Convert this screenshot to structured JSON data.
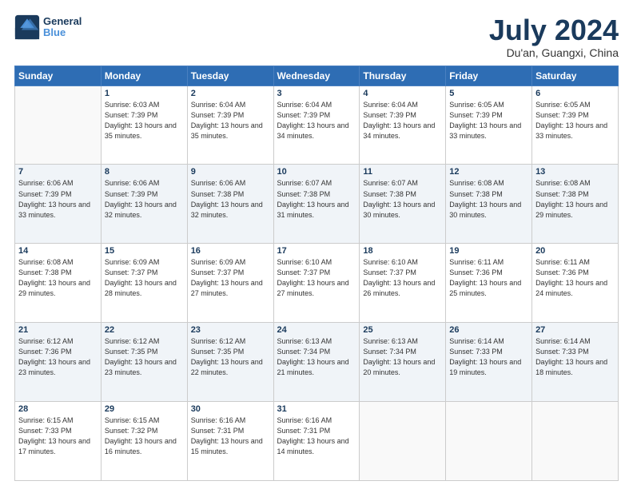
{
  "header": {
    "logo_line1": "General",
    "logo_line2": "Blue",
    "month_year": "July 2024",
    "location": "Du'an, Guangxi, China"
  },
  "days_of_week": [
    "Sunday",
    "Monday",
    "Tuesday",
    "Wednesday",
    "Thursday",
    "Friday",
    "Saturday"
  ],
  "weeks": [
    [
      {
        "day": "",
        "sunrise": "",
        "sunset": "",
        "daylight": ""
      },
      {
        "day": "1",
        "sunrise": "Sunrise: 6:03 AM",
        "sunset": "Sunset: 7:39 PM",
        "daylight": "Daylight: 13 hours and 35 minutes."
      },
      {
        "day": "2",
        "sunrise": "Sunrise: 6:04 AM",
        "sunset": "Sunset: 7:39 PM",
        "daylight": "Daylight: 13 hours and 35 minutes."
      },
      {
        "day": "3",
        "sunrise": "Sunrise: 6:04 AM",
        "sunset": "Sunset: 7:39 PM",
        "daylight": "Daylight: 13 hours and 34 minutes."
      },
      {
        "day": "4",
        "sunrise": "Sunrise: 6:04 AM",
        "sunset": "Sunset: 7:39 PM",
        "daylight": "Daylight: 13 hours and 34 minutes."
      },
      {
        "day": "5",
        "sunrise": "Sunrise: 6:05 AM",
        "sunset": "Sunset: 7:39 PM",
        "daylight": "Daylight: 13 hours and 33 minutes."
      },
      {
        "day": "6",
        "sunrise": "Sunrise: 6:05 AM",
        "sunset": "Sunset: 7:39 PM",
        "daylight": "Daylight: 13 hours and 33 minutes."
      }
    ],
    [
      {
        "day": "7",
        "sunrise": "Sunrise: 6:06 AM",
        "sunset": "Sunset: 7:39 PM",
        "daylight": "Daylight: 13 hours and 33 minutes."
      },
      {
        "day": "8",
        "sunrise": "Sunrise: 6:06 AM",
        "sunset": "Sunset: 7:39 PM",
        "daylight": "Daylight: 13 hours and 32 minutes."
      },
      {
        "day": "9",
        "sunrise": "Sunrise: 6:06 AM",
        "sunset": "Sunset: 7:38 PM",
        "daylight": "Daylight: 13 hours and 32 minutes."
      },
      {
        "day": "10",
        "sunrise": "Sunrise: 6:07 AM",
        "sunset": "Sunset: 7:38 PM",
        "daylight": "Daylight: 13 hours and 31 minutes."
      },
      {
        "day": "11",
        "sunrise": "Sunrise: 6:07 AM",
        "sunset": "Sunset: 7:38 PM",
        "daylight": "Daylight: 13 hours and 30 minutes."
      },
      {
        "day": "12",
        "sunrise": "Sunrise: 6:08 AM",
        "sunset": "Sunset: 7:38 PM",
        "daylight": "Daylight: 13 hours and 30 minutes."
      },
      {
        "day": "13",
        "sunrise": "Sunrise: 6:08 AM",
        "sunset": "Sunset: 7:38 PM",
        "daylight": "Daylight: 13 hours and 29 minutes."
      }
    ],
    [
      {
        "day": "14",
        "sunrise": "Sunrise: 6:08 AM",
        "sunset": "Sunset: 7:38 PM",
        "daylight": "Daylight: 13 hours and 29 minutes."
      },
      {
        "day": "15",
        "sunrise": "Sunrise: 6:09 AM",
        "sunset": "Sunset: 7:37 PM",
        "daylight": "Daylight: 13 hours and 28 minutes."
      },
      {
        "day": "16",
        "sunrise": "Sunrise: 6:09 AM",
        "sunset": "Sunset: 7:37 PM",
        "daylight": "Daylight: 13 hours and 27 minutes."
      },
      {
        "day": "17",
        "sunrise": "Sunrise: 6:10 AM",
        "sunset": "Sunset: 7:37 PM",
        "daylight": "Daylight: 13 hours and 27 minutes."
      },
      {
        "day": "18",
        "sunrise": "Sunrise: 6:10 AM",
        "sunset": "Sunset: 7:37 PM",
        "daylight": "Daylight: 13 hours and 26 minutes."
      },
      {
        "day": "19",
        "sunrise": "Sunrise: 6:11 AM",
        "sunset": "Sunset: 7:36 PM",
        "daylight": "Daylight: 13 hours and 25 minutes."
      },
      {
        "day": "20",
        "sunrise": "Sunrise: 6:11 AM",
        "sunset": "Sunset: 7:36 PM",
        "daylight": "Daylight: 13 hours and 24 minutes."
      }
    ],
    [
      {
        "day": "21",
        "sunrise": "Sunrise: 6:12 AM",
        "sunset": "Sunset: 7:36 PM",
        "daylight": "Daylight: 13 hours and 23 minutes."
      },
      {
        "day": "22",
        "sunrise": "Sunrise: 6:12 AM",
        "sunset": "Sunset: 7:35 PM",
        "daylight": "Daylight: 13 hours and 23 minutes."
      },
      {
        "day": "23",
        "sunrise": "Sunrise: 6:12 AM",
        "sunset": "Sunset: 7:35 PM",
        "daylight": "Daylight: 13 hours and 22 minutes."
      },
      {
        "day": "24",
        "sunrise": "Sunrise: 6:13 AM",
        "sunset": "Sunset: 7:34 PM",
        "daylight": "Daylight: 13 hours and 21 minutes."
      },
      {
        "day": "25",
        "sunrise": "Sunrise: 6:13 AM",
        "sunset": "Sunset: 7:34 PM",
        "daylight": "Daylight: 13 hours and 20 minutes."
      },
      {
        "day": "26",
        "sunrise": "Sunrise: 6:14 AM",
        "sunset": "Sunset: 7:33 PM",
        "daylight": "Daylight: 13 hours and 19 minutes."
      },
      {
        "day": "27",
        "sunrise": "Sunrise: 6:14 AM",
        "sunset": "Sunset: 7:33 PM",
        "daylight": "Daylight: 13 hours and 18 minutes."
      }
    ],
    [
      {
        "day": "28",
        "sunrise": "Sunrise: 6:15 AM",
        "sunset": "Sunset: 7:33 PM",
        "daylight": "Daylight: 13 hours and 17 minutes."
      },
      {
        "day": "29",
        "sunrise": "Sunrise: 6:15 AM",
        "sunset": "Sunset: 7:32 PM",
        "daylight": "Daylight: 13 hours and 16 minutes."
      },
      {
        "day": "30",
        "sunrise": "Sunrise: 6:16 AM",
        "sunset": "Sunset: 7:31 PM",
        "daylight": "Daylight: 13 hours and 15 minutes."
      },
      {
        "day": "31",
        "sunrise": "Sunrise: 6:16 AM",
        "sunset": "Sunset: 7:31 PM",
        "daylight": "Daylight: 13 hours and 14 minutes."
      },
      {
        "day": "",
        "sunrise": "",
        "sunset": "",
        "daylight": ""
      },
      {
        "day": "",
        "sunrise": "",
        "sunset": "",
        "daylight": ""
      },
      {
        "day": "",
        "sunrise": "",
        "sunset": "",
        "daylight": ""
      }
    ]
  ]
}
